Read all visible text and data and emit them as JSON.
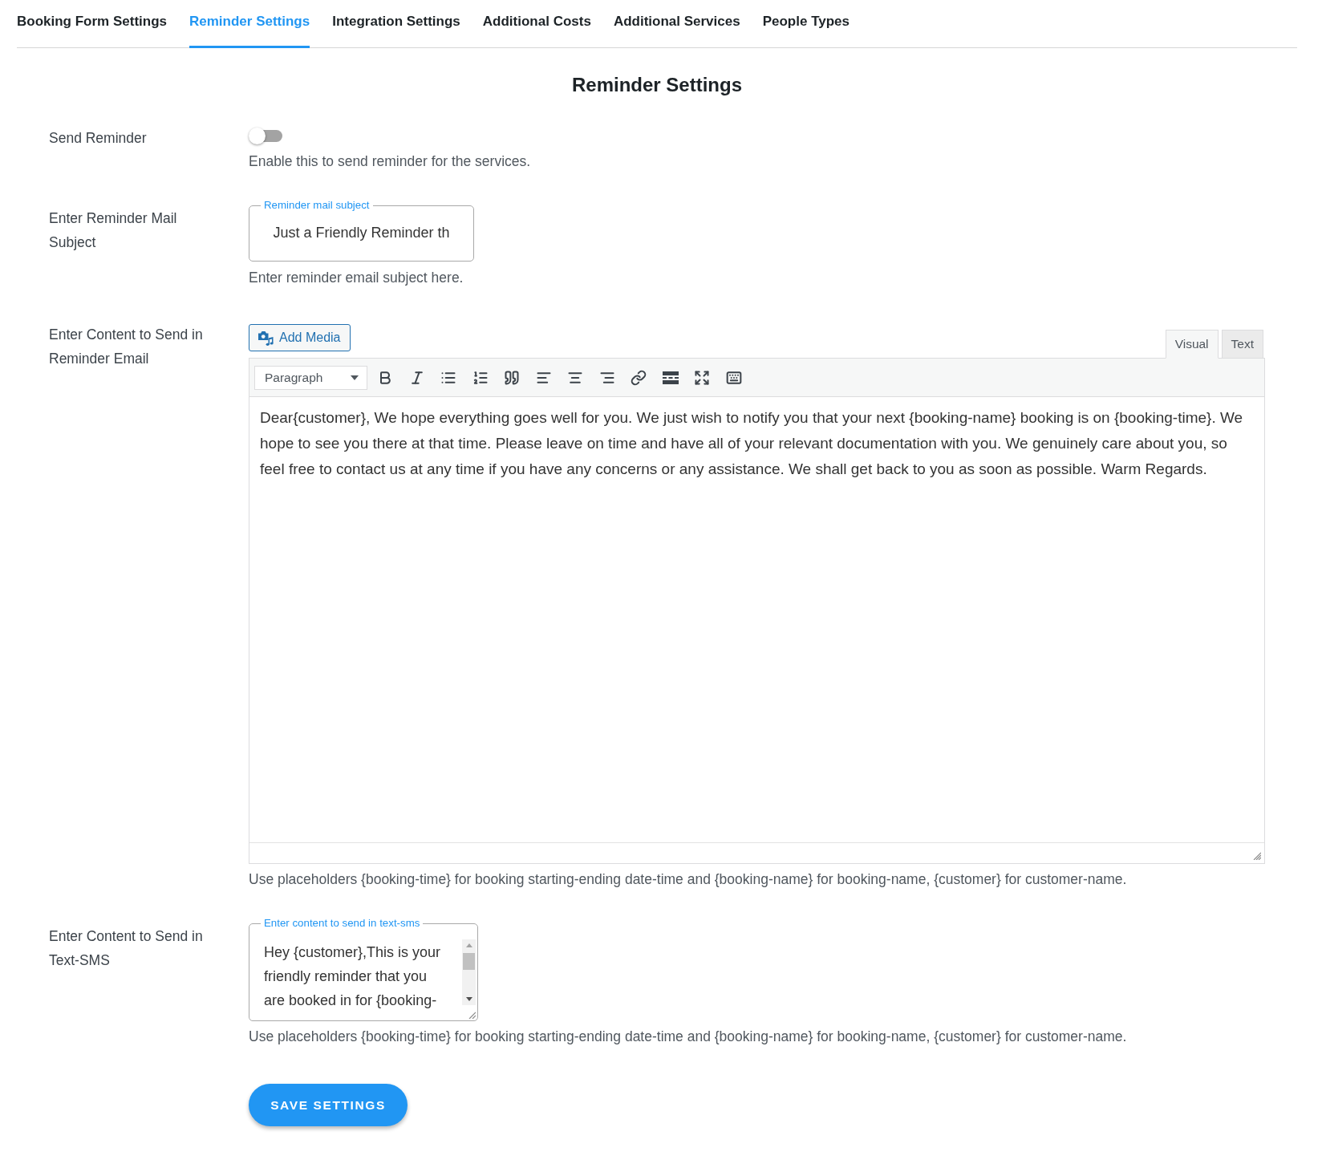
{
  "tabs": [
    {
      "label": "Booking Form Settings",
      "selected": false
    },
    {
      "label": "Reminder Settings",
      "selected": true
    },
    {
      "label": "Integration Settings",
      "selected": false
    },
    {
      "label": "Additional Costs",
      "selected": false
    },
    {
      "label": "Additional Services",
      "selected": false
    },
    {
      "label": "People Types",
      "selected": false
    }
  ],
  "title": "Reminder Settings",
  "send_reminder": {
    "label": "Send Reminder",
    "on": false,
    "help": "Enable this to send reminder for the services."
  },
  "mail_subject": {
    "label": "Enter Reminder Mail Subject",
    "floating_label": "Reminder mail subject",
    "value": "Just a Friendly Reminder th",
    "help": "Enter reminder email subject here."
  },
  "email_content": {
    "label": "Enter Content to Send in Reminder Email",
    "add_media": "Add Media",
    "editor_tabs": [
      {
        "label": "Visual",
        "selected": true
      },
      {
        "label": "Text",
        "selected": false
      }
    ],
    "format": "Paragraph",
    "value": "Dear{customer}, We hope everything goes well for you. We just wish to notify you that your next {booking-name} booking is on {booking-time}. We hope to see you there at that time. Please leave on time and have all of your relevant documentation with you. We genuinely care about you, so feel free to contact us at any time if you have any concerns or any assistance. We shall get back to you as soon as possible. Warm Regards.",
    "help": "Use placeholders {booking-time} for booking starting-ending date-time and {booking-name} for booking-name, {customer} for customer-name."
  },
  "sms_content": {
    "label": "Enter Content to Send in Text-SMS",
    "floating_label": "Enter content to send in text-sms",
    "value": "Hey {customer},This is your friendly reminder that you are booked in for {booking-",
    "help": "Use placeholders {booking-time} for booking starting-ending date-time and {booking-name} for booking-name, {customer} for customer-name."
  },
  "save_button": "SAVE SETTINGS"
}
